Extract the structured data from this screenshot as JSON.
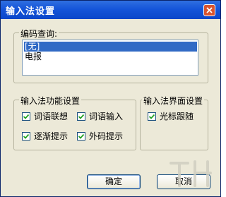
{
  "window": {
    "title": "输入法设置"
  },
  "encoding_query": {
    "label": "编码查询:",
    "items": [
      {
        "label": "[无]",
        "selected": true
      },
      {
        "label": "电报",
        "selected": false
      }
    ]
  },
  "function_settings": {
    "label": "输入法功能设置",
    "word_association": {
      "label": "词语联想",
      "checked": true
    },
    "word_input": {
      "label": "词语输入",
      "checked": true
    },
    "gradual_hint": {
      "label": "逐渐提示",
      "checked": true
    },
    "external_code_hint": {
      "label": "外码提示",
      "checked": true
    }
  },
  "interface_settings": {
    "label": "输入法界面设置",
    "cursor_follow": {
      "label": "光标跟随",
      "checked": true
    }
  },
  "buttons": {
    "ok": "确定",
    "cancel": "取消"
  },
  "icons": {
    "close": "close-icon",
    "check": "checkmark-icon"
  },
  "colors": {
    "title_bar": "#0b47c9",
    "selection": "#316ac5",
    "dialog_bg": "#ece9d8"
  }
}
